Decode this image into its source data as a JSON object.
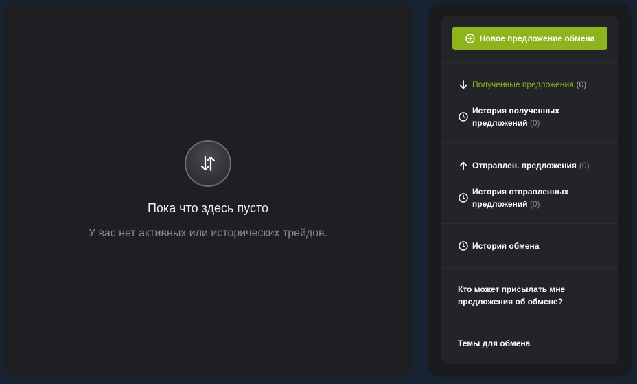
{
  "empty": {
    "title": "Пока что здесь пусто",
    "subtitle": "У вас нет активных или исторических трейдов."
  },
  "sidebar": {
    "new_offer_label": "Новое предложение обмена",
    "received": {
      "label": "Полученные предложения",
      "count": "(0)"
    },
    "received_history": {
      "label": "История полученных предложений",
      "count": "(0)"
    },
    "sent": {
      "label": "Отправлен. предложения",
      "count": "(0)"
    },
    "sent_history": {
      "label": "История отправленных предложений",
      "count": "(0)"
    },
    "trade_history": {
      "label": "История обмена"
    },
    "who_can_send": {
      "label": "Кто может присылать мне предложения об обмене?"
    },
    "trade_topics": {
      "label": "Темы для обмена"
    }
  },
  "colors": {
    "accent": "#8db41c",
    "panel": "#1e1f22",
    "background": "#172332"
  }
}
